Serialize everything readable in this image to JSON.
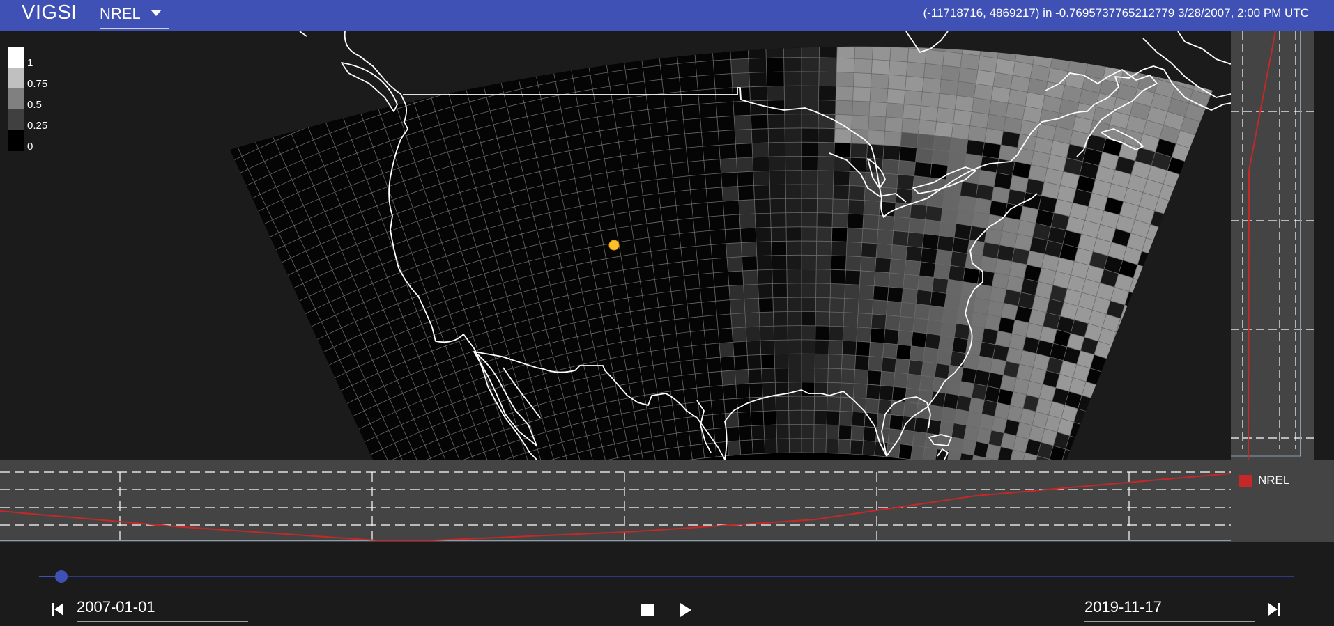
{
  "app": {
    "title": "VIGSI"
  },
  "source_selector": {
    "selected": "NREL"
  },
  "status": {
    "text": "(-11718716, 4869217) in -0.7695737765212779 3/28/2007, 2:00 PM UTC"
  },
  "map_legend": [
    {
      "label": "1",
      "color": "#ffffff"
    },
    {
      "label": "0.75",
      "color": "#c0c0c0"
    },
    {
      "label": "0.5",
      "color": "#808080"
    },
    {
      "label": "0.25",
      "color": "#404040"
    },
    {
      "label": "0",
      "color": "#000000"
    }
  ],
  "series_legend": {
    "label": "NREL",
    "color": "#c62828"
  },
  "timeline": {
    "start_date": "2007-01-01",
    "end_date": "2019-11-17",
    "position_fraction": 0.018
  },
  "icons": {
    "skip_start": "skip-previous-icon",
    "stop": "stop-icon",
    "play": "play-icon",
    "skip_end": "skip-next-icon",
    "dropdown": "caret-down-icon",
    "location": "location-marker-icon"
  },
  "colors": {
    "app_bar": "#3f51b5",
    "background": "#1b1b1b",
    "chart_panel": "#444444",
    "series_line": "#c62828",
    "marker": "#fbc02d"
  }
}
